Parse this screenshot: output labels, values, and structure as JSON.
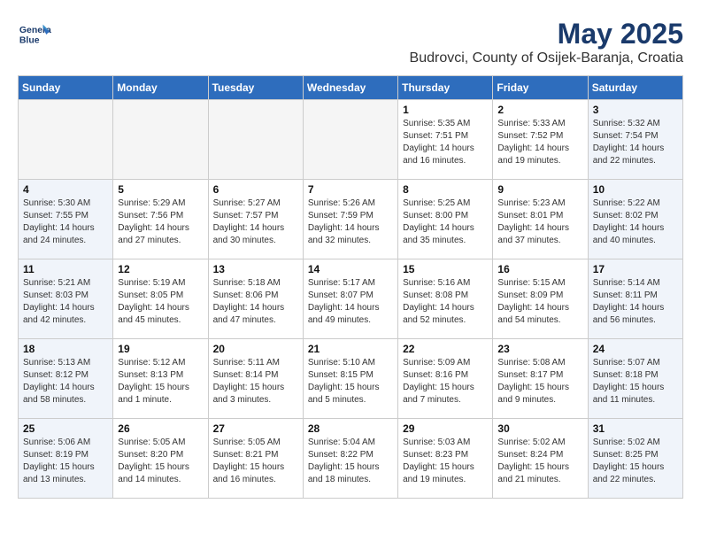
{
  "header": {
    "logo_line1": "General",
    "logo_line2": "Blue",
    "month": "May 2025",
    "location": "Budrovci, County of Osijek-Baranja, Croatia"
  },
  "weekdays": [
    "Sunday",
    "Monday",
    "Tuesday",
    "Wednesday",
    "Thursday",
    "Friday",
    "Saturday"
  ],
  "weeks": [
    [
      {
        "day": "",
        "detail": "",
        "empty": true
      },
      {
        "day": "",
        "detail": "",
        "empty": true
      },
      {
        "day": "",
        "detail": "",
        "empty": true
      },
      {
        "day": "",
        "detail": "",
        "empty": true
      },
      {
        "day": "1",
        "detail": "Sunrise: 5:35 AM\nSunset: 7:51 PM\nDaylight: 14 hours\nand 16 minutes.",
        "shaded": false
      },
      {
        "day": "2",
        "detail": "Sunrise: 5:33 AM\nSunset: 7:52 PM\nDaylight: 14 hours\nand 19 minutes.",
        "shaded": false
      },
      {
        "day": "3",
        "detail": "Sunrise: 5:32 AM\nSunset: 7:54 PM\nDaylight: 14 hours\nand 22 minutes.",
        "shaded": true
      }
    ],
    [
      {
        "day": "4",
        "detail": "Sunrise: 5:30 AM\nSunset: 7:55 PM\nDaylight: 14 hours\nand 24 minutes.",
        "shaded": true
      },
      {
        "day": "5",
        "detail": "Sunrise: 5:29 AM\nSunset: 7:56 PM\nDaylight: 14 hours\nand 27 minutes.",
        "shaded": false
      },
      {
        "day": "6",
        "detail": "Sunrise: 5:27 AM\nSunset: 7:57 PM\nDaylight: 14 hours\nand 30 minutes.",
        "shaded": false
      },
      {
        "day": "7",
        "detail": "Sunrise: 5:26 AM\nSunset: 7:59 PM\nDaylight: 14 hours\nand 32 minutes.",
        "shaded": false
      },
      {
        "day": "8",
        "detail": "Sunrise: 5:25 AM\nSunset: 8:00 PM\nDaylight: 14 hours\nand 35 minutes.",
        "shaded": false
      },
      {
        "day": "9",
        "detail": "Sunrise: 5:23 AM\nSunset: 8:01 PM\nDaylight: 14 hours\nand 37 minutes.",
        "shaded": false
      },
      {
        "day": "10",
        "detail": "Sunrise: 5:22 AM\nSunset: 8:02 PM\nDaylight: 14 hours\nand 40 minutes.",
        "shaded": true
      }
    ],
    [
      {
        "day": "11",
        "detail": "Sunrise: 5:21 AM\nSunset: 8:03 PM\nDaylight: 14 hours\nand 42 minutes.",
        "shaded": true
      },
      {
        "day": "12",
        "detail": "Sunrise: 5:19 AM\nSunset: 8:05 PM\nDaylight: 14 hours\nand 45 minutes.",
        "shaded": false
      },
      {
        "day": "13",
        "detail": "Sunrise: 5:18 AM\nSunset: 8:06 PM\nDaylight: 14 hours\nand 47 minutes.",
        "shaded": false
      },
      {
        "day": "14",
        "detail": "Sunrise: 5:17 AM\nSunset: 8:07 PM\nDaylight: 14 hours\nand 49 minutes.",
        "shaded": false
      },
      {
        "day": "15",
        "detail": "Sunrise: 5:16 AM\nSunset: 8:08 PM\nDaylight: 14 hours\nand 52 minutes.",
        "shaded": false
      },
      {
        "day": "16",
        "detail": "Sunrise: 5:15 AM\nSunset: 8:09 PM\nDaylight: 14 hours\nand 54 minutes.",
        "shaded": false
      },
      {
        "day": "17",
        "detail": "Sunrise: 5:14 AM\nSunset: 8:11 PM\nDaylight: 14 hours\nand 56 minutes.",
        "shaded": true
      }
    ],
    [
      {
        "day": "18",
        "detail": "Sunrise: 5:13 AM\nSunset: 8:12 PM\nDaylight: 14 hours\nand 58 minutes.",
        "shaded": true
      },
      {
        "day": "19",
        "detail": "Sunrise: 5:12 AM\nSunset: 8:13 PM\nDaylight: 15 hours\nand 1 minute.",
        "shaded": false
      },
      {
        "day": "20",
        "detail": "Sunrise: 5:11 AM\nSunset: 8:14 PM\nDaylight: 15 hours\nand 3 minutes.",
        "shaded": false
      },
      {
        "day": "21",
        "detail": "Sunrise: 5:10 AM\nSunset: 8:15 PM\nDaylight: 15 hours\nand 5 minutes.",
        "shaded": false
      },
      {
        "day": "22",
        "detail": "Sunrise: 5:09 AM\nSunset: 8:16 PM\nDaylight: 15 hours\nand 7 minutes.",
        "shaded": false
      },
      {
        "day": "23",
        "detail": "Sunrise: 5:08 AM\nSunset: 8:17 PM\nDaylight: 15 hours\nand 9 minutes.",
        "shaded": false
      },
      {
        "day": "24",
        "detail": "Sunrise: 5:07 AM\nSunset: 8:18 PM\nDaylight: 15 hours\nand 11 minutes.",
        "shaded": true
      }
    ],
    [
      {
        "day": "25",
        "detail": "Sunrise: 5:06 AM\nSunset: 8:19 PM\nDaylight: 15 hours\nand 13 minutes.",
        "shaded": true
      },
      {
        "day": "26",
        "detail": "Sunrise: 5:05 AM\nSunset: 8:20 PM\nDaylight: 15 hours\nand 14 minutes.",
        "shaded": false
      },
      {
        "day": "27",
        "detail": "Sunrise: 5:05 AM\nSunset: 8:21 PM\nDaylight: 15 hours\nand 16 minutes.",
        "shaded": false
      },
      {
        "day": "28",
        "detail": "Sunrise: 5:04 AM\nSunset: 8:22 PM\nDaylight: 15 hours\nand 18 minutes.",
        "shaded": false
      },
      {
        "day": "29",
        "detail": "Sunrise: 5:03 AM\nSunset: 8:23 PM\nDaylight: 15 hours\nand 19 minutes.",
        "shaded": false
      },
      {
        "day": "30",
        "detail": "Sunrise: 5:02 AM\nSunset: 8:24 PM\nDaylight: 15 hours\nand 21 minutes.",
        "shaded": false
      },
      {
        "day": "31",
        "detail": "Sunrise: 5:02 AM\nSunset: 8:25 PM\nDaylight: 15 hours\nand 22 minutes.",
        "shaded": true
      }
    ]
  ]
}
